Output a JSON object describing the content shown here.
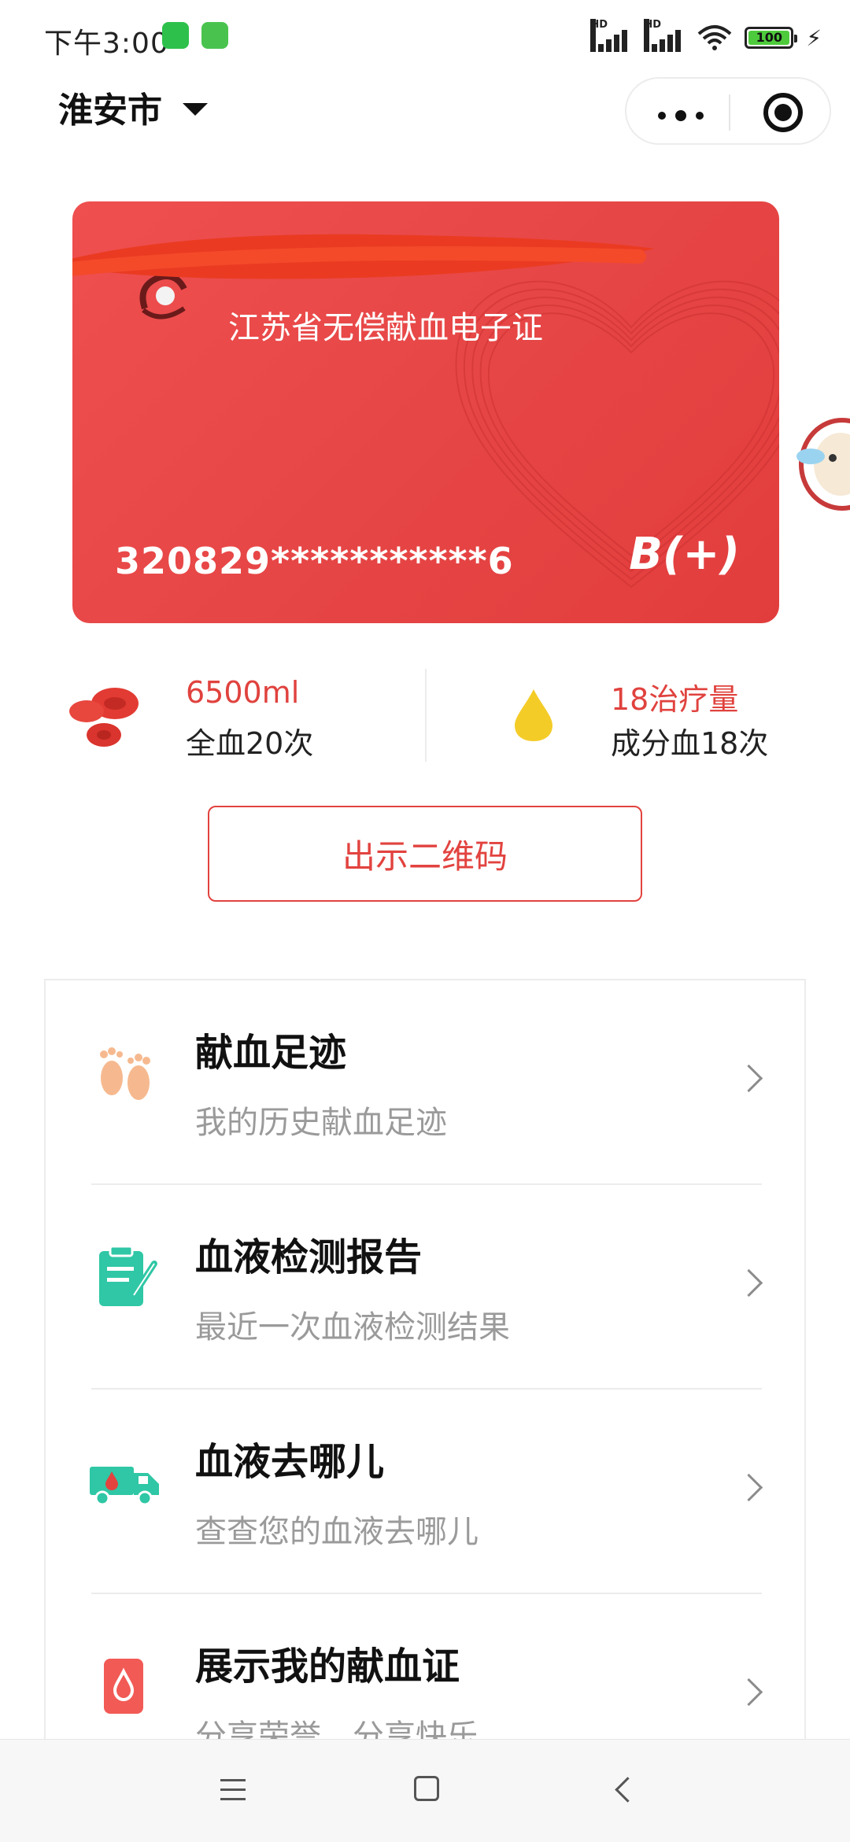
{
  "status_bar": {
    "time": "下午3:00",
    "apps": [
      "wechat-icon",
      "app-icon"
    ],
    "signal_labels": [
      "HD",
      "HD"
    ],
    "battery": "100"
  },
  "header": {
    "city": "淮安市"
  },
  "card": {
    "title": "江苏省无偿献血电子证",
    "id_masked": "320829***********6",
    "blood_type": "B(+)",
    "bg_color": "#e84848"
  },
  "stats": {
    "whole_blood": {
      "value": "6500ml",
      "label": "全血20次"
    },
    "component_blood": {
      "value": "18治疗量",
      "label": "成分血18次"
    }
  },
  "qr_button": {
    "label": "出示二维码"
  },
  "menu": [
    {
      "title": "献血足迹",
      "subtitle": "我的历史献血足迹",
      "icon": "footprints-icon"
    },
    {
      "title": "血液检测报告",
      "subtitle": "最近一次血液检测结果",
      "icon": "report-icon"
    },
    {
      "title": "血液去哪儿",
      "subtitle": "查查您的血液去哪儿",
      "icon": "truck-icon"
    },
    {
      "title": "展示我的献血证",
      "subtitle": "分享荣誉　分享快乐",
      "icon": "blood-drop-icon"
    }
  ],
  "colors": {
    "accent": "#e2433f",
    "teal": "#2fc7a5"
  }
}
